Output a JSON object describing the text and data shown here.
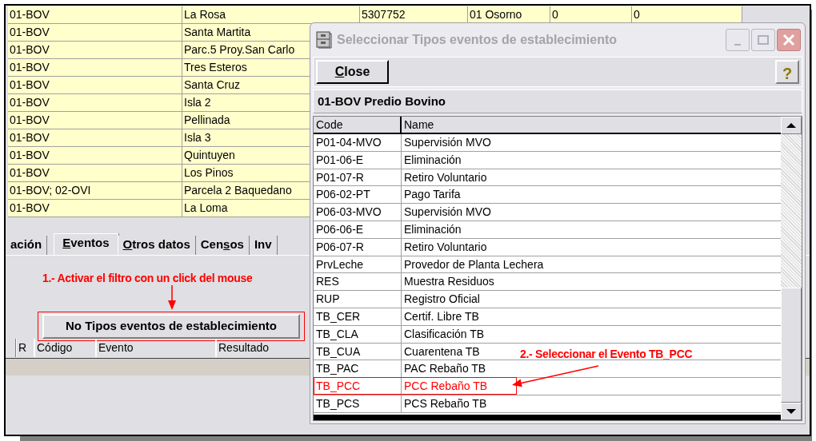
{
  "records": {
    "rows": [
      {
        "cells": [
          "01-BOV",
          "La Rosa",
          "5307752",
          "01 Osorno",
          "0",
          "0"
        ]
      },
      {
        "cells": [
          "01-BOV",
          "Santa Martita"
        ]
      },
      {
        "cells": [
          "01-BOV",
          "Parc.5 Proy.San Carlo"
        ]
      },
      {
        "cells": [
          "01-BOV",
          "Tres Esteros"
        ]
      },
      {
        "cells": [
          "01-BOV",
          "Santa Cruz"
        ]
      },
      {
        "cells": [
          "01-BOV",
          "Isla 2"
        ]
      },
      {
        "cells": [
          "01-BOV",
          "Pellinada"
        ]
      },
      {
        "cells": [
          "01-BOV",
          "Isla 3"
        ]
      },
      {
        "cells": [
          "01-BOV",
          "Quintuyen"
        ]
      },
      {
        "cells": [
          "01-BOV",
          "Los Pinos"
        ]
      },
      {
        "cells": [
          "01-BOV; 02-OVI",
          "Parcela 2 Baquedano"
        ]
      },
      {
        "cells": [
          "01-BOV",
          "La Loma"
        ]
      }
    ]
  },
  "tabs": [
    {
      "before": "ación",
      "selected": false
    },
    {
      "key": "E",
      "after": "ventos",
      "selected": true
    },
    {
      "key": "O",
      "after": "tros datos",
      "selected": false
    },
    {
      "before": "Cen",
      "key": "s",
      "after": "os",
      "selected": false
    },
    {
      "before": "Inv",
      "selected": false
    }
  ],
  "filter_button": "No Tipos eventos de establecimiento",
  "events_table": {
    "columns": [
      "R",
      "Código",
      "Evento",
      "Resultado"
    ]
  },
  "dialog": {
    "title": "Seleccionar Tipos eventos de establecimiento",
    "close_button": {
      "key": "C",
      "after": "lose"
    },
    "help_button": "?",
    "group": "01-BOV Predio Bovino",
    "columns": [
      "Code",
      "Name"
    ],
    "rows": [
      {
        "code": "P01-04-MVO",
        "name": "Supervisión MVO",
        "highlighted": false
      },
      {
        "code": "P01-06-E",
        "name": "Eliminación",
        "highlighted": false
      },
      {
        "code": "P01-07-R",
        "name": "Retiro Voluntario",
        "highlighted": false
      },
      {
        "code": "P06-02-PT",
        "name": "Pago Tarifa",
        "highlighted": false
      },
      {
        "code": "P06-03-MVO",
        "name": "Supervisión MVO",
        "highlighted": false
      },
      {
        "code": "P06-06-E",
        "name": "Eliminación",
        "highlighted": false
      },
      {
        "code": "P06-07-R",
        "name": "Retiro Voluntario",
        "highlighted": false
      },
      {
        "code": "PrvLeche",
        "name": "Provedor de Planta Lechera",
        "highlighted": false
      },
      {
        "code": "RES",
        "name": "Muestra Residuos",
        "highlighted": false
      },
      {
        "code": "RUP",
        "name": "Registro Oficial",
        "highlighted": false
      },
      {
        "code": "TB_CER",
        "name": "Certif. Libre TB",
        "highlighted": false
      },
      {
        "code": "TB_CLA",
        "name": "Clasificación TB",
        "highlighted": false
      },
      {
        "code": "TB_CUA",
        "name": "Cuarentena TB",
        "highlighted": false
      },
      {
        "code": "TB_PAC",
        "name": "PAC Rebaño TB",
        "highlighted": false
      },
      {
        "code": "TB_PCC",
        "name": "PCC Rebaño TB",
        "highlighted": true
      },
      {
        "code": "TB_PCS",
        "name": "PCS Rebaño TB",
        "highlighted": false
      }
    ]
  },
  "annotations": [
    {
      "text": "1.- Activar el filtro con un click del mouse"
    },
    {
      "text": "2.- Seleccionar el Evento TB_PCC"
    }
  ]
}
